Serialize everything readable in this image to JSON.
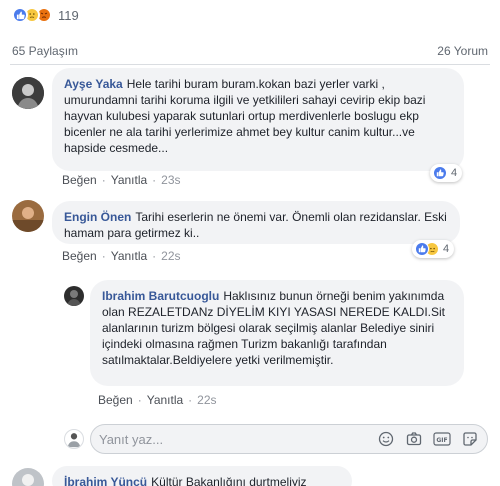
{
  "reactions": {
    "count": "119",
    "icons": [
      "like-icon",
      "sad-icon",
      "angry-icon"
    ]
  },
  "stats": {
    "shares": "65 Paylaşım",
    "comments": "26 Yorum"
  },
  "comments": [
    {
      "author": "Ayşe Yaka",
      "text": "Hele tarihi buram buram.kokan bazi yerler varki , umurundamni tarihi koruma ilgili ve yetkilileri sahayi cevirip ekip bazi hayvan kulubesi yaparak sutunlari ortup merdivenlerle boslugu ekp bicenler ne ala tarihi yerlerimize ahmet bey kultur canim kultur...ve hapside cesmede...",
      "like": "Beğen",
      "reply": "Yanıtla",
      "time": "23s",
      "reaction_count": "4"
    },
    {
      "author": "Engin Önen",
      "text": "Tarihi eserlerin ne önemi var. Önemli olan rezidanslar. Eski hamam para getirmez ki..",
      "like": "Beğen",
      "reply": "Yanıtla",
      "time": "22s",
      "reaction_count": "4"
    },
    {
      "author": "Ibrahim Barutcuoglu",
      "text": "Haklısınız bunun örneği benim yakınımda olan REZALETDANz DİYELİM KIYI YASASI NEREDE KALDI.Sit alanlarının turizm bölgesi olarak seçilmiş alanlar Belediye siniri içindeki olmasına rağmen Turizm bakanlığı tarafından satılmaktalar.Beldiyelere yetki verilmemiştir.",
      "like": "Beğen",
      "reply": "Yanıtla",
      "time": "22s"
    },
    {
      "author": "İbrahim Yüncü",
      "text": "Kültür Bakanlığını durtmeliyiz"
    }
  ],
  "reply_input": {
    "placeholder": "Yanıt yaz..."
  },
  "colors": {
    "link": "#385898",
    "bubble": "#f2f3f5",
    "like": "#4b7bec"
  }
}
